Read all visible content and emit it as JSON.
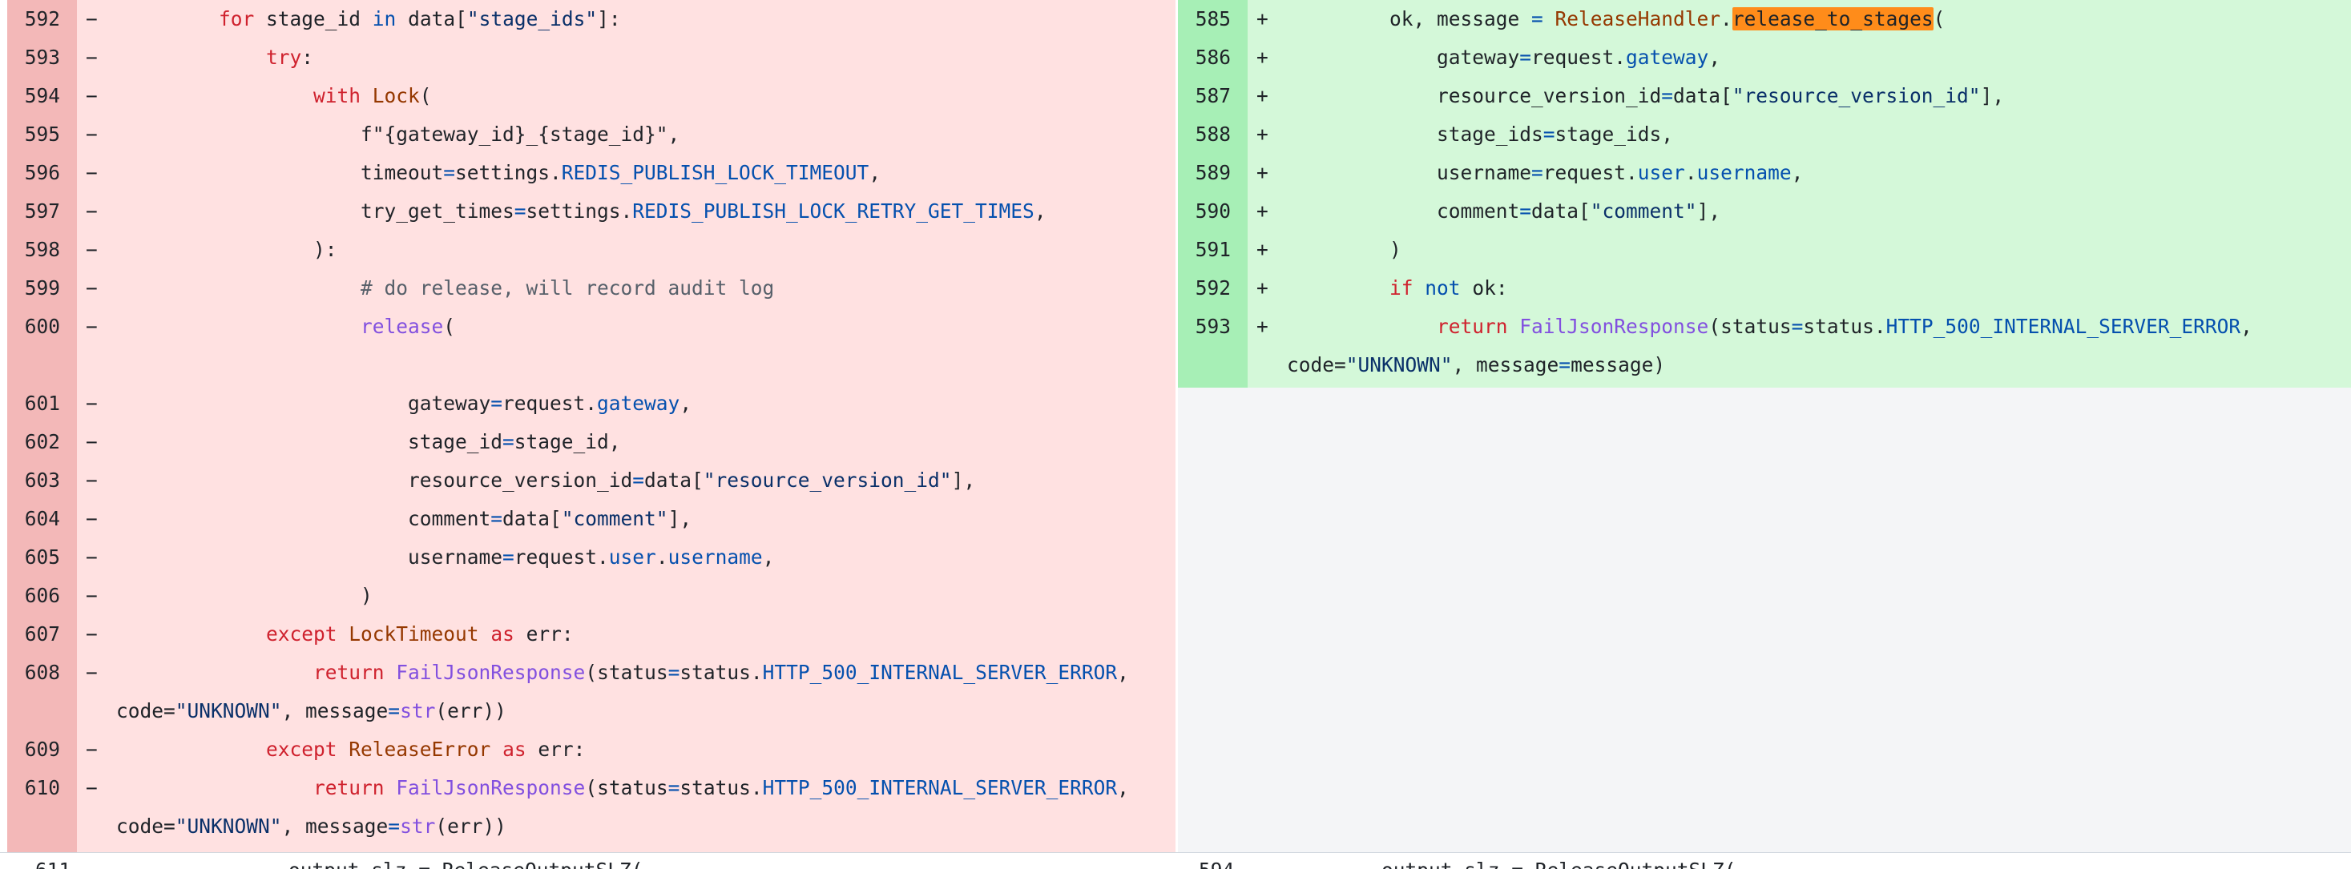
{
  "left": {
    "sign": "−",
    "rows": [
      {
        "ln": "592",
        "segs": [
          [
            "",
            "        "
          ],
          [
            "kw",
            "for"
          ],
          [
            "",
            " stage_id "
          ],
          [
            "kw2",
            "in"
          ],
          [
            "",
            " data["
          ],
          [
            "str",
            "\"stage_ids\""
          ],
          [
            "",
            "]:"
          ]
        ]
      },
      {
        "ln": "593",
        "segs": [
          [
            "",
            "            "
          ],
          [
            "kw",
            "try"
          ],
          [
            "",
            ":"
          ]
        ]
      },
      {
        "ln": "594",
        "segs": [
          [
            "",
            "                "
          ],
          [
            "kw",
            "with"
          ],
          [
            "fn",
            " Lock"
          ],
          [
            "",
            "("
          ]
        ]
      },
      {
        "ln": "595",
        "segs": [
          [
            "",
            "                    "
          ],
          [
            "",
            "f\"{gateway_id}_{stage_id}\","
          ]
        ]
      },
      {
        "ln": "596",
        "segs": [
          [
            "",
            "                    timeout"
          ],
          [
            "kw2",
            "="
          ],
          [
            "",
            "settings."
          ],
          [
            "attr",
            "REDIS_PUBLISH_LOCK_TIMEOUT"
          ],
          [
            "",
            ","
          ]
        ]
      },
      {
        "ln": "597",
        "segs": [
          [
            "",
            "                    try_get_times"
          ],
          [
            "kw2",
            "="
          ],
          [
            "",
            "settings."
          ],
          [
            "attr",
            "REDIS_PUBLISH_LOCK_RETRY_GET_TIMES"
          ],
          [
            "",
            ","
          ]
        ]
      },
      {
        "ln": "598",
        "segs": [
          [
            "",
            "                ):"
          ]
        ]
      },
      {
        "ln": "599",
        "segs": [
          [
            "cm",
            "                    # do release, will record audit log"
          ]
        ]
      },
      {
        "ln": "600",
        "segs": [
          [
            "",
            "                    "
          ],
          [
            "cls",
            "release"
          ],
          [
            "",
            "("
          ]
        ]
      },
      {
        "ln": "",
        "segs": [
          [
            "",
            ""
          ]
        ]
      },
      {
        "ln": "601",
        "segs": [
          [
            "",
            "                        gateway"
          ],
          [
            "kw2",
            "="
          ],
          [
            "",
            "request."
          ],
          [
            "attr",
            "gateway"
          ],
          [
            "",
            ","
          ]
        ]
      },
      {
        "ln": "602",
        "segs": [
          [
            "",
            "                        stage_id"
          ],
          [
            "kw2",
            "="
          ],
          [
            "",
            "stage_id,"
          ]
        ]
      },
      {
        "ln": "603",
        "segs": [
          [
            "",
            "                        resource_version_id"
          ],
          [
            "kw2",
            "="
          ],
          [
            "",
            "data["
          ],
          [
            "str",
            "\"resource_version_id\""
          ],
          [
            "",
            "],"
          ]
        ]
      },
      {
        "ln": "604",
        "segs": [
          [
            "",
            "                        comment"
          ],
          [
            "kw2",
            "="
          ],
          [
            "",
            "data["
          ],
          [
            "str",
            "\"comment\""
          ],
          [
            "",
            "],"
          ]
        ]
      },
      {
        "ln": "605",
        "segs": [
          [
            "",
            "                        username"
          ],
          [
            "kw2",
            "="
          ],
          [
            "",
            "request."
          ],
          [
            "attr",
            "user"
          ],
          [
            "",
            "."
          ],
          [
            "attr",
            "username"
          ],
          [
            "",
            ","
          ]
        ]
      },
      {
        "ln": "606",
        "segs": [
          [
            "",
            "                    )"
          ]
        ]
      },
      {
        "ln": "607",
        "segs": [
          [
            "",
            "            "
          ],
          [
            "kw",
            "except"
          ],
          [
            "fn",
            " LockTimeout"
          ],
          [
            "",
            " "
          ],
          [
            "kw",
            "as"
          ],
          [
            "",
            " err:"
          ]
        ]
      },
      {
        "ln": "608",
        "segs": [
          [
            "",
            "                "
          ],
          [
            "kw",
            "return"
          ],
          [
            "",
            " "
          ],
          [
            "cls",
            "FailJsonResponse"
          ],
          [
            "",
            "(status"
          ],
          [
            "kw2",
            "="
          ],
          [
            "",
            "status."
          ],
          [
            "attr",
            "HTTP_500_INTERNAL_SERVER_ERROR"
          ],
          [
            "",
            ","
          ]
        ]
      },
      {
        "ln": "",
        "cont": true,
        "segs": [
          [
            "",
            "code="
          ],
          [
            "str",
            "\"UNKNOWN\""
          ],
          [
            "",
            ", message"
          ],
          [
            "kw2",
            "="
          ],
          [
            "cls",
            "str"
          ],
          [
            "",
            "(err))"
          ]
        ]
      },
      {
        "ln": "609",
        "segs": [
          [
            "",
            "            "
          ],
          [
            "kw",
            "except"
          ],
          [
            "fn",
            " ReleaseError"
          ],
          [
            "",
            " "
          ],
          [
            "kw",
            "as"
          ],
          [
            "",
            " err:"
          ]
        ]
      },
      {
        "ln": "610",
        "segs": [
          [
            "",
            "                "
          ],
          [
            "kw",
            "return"
          ],
          [
            "",
            " "
          ],
          [
            "cls",
            "FailJsonResponse"
          ],
          [
            "",
            "(status"
          ],
          [
            "kw2",
            "="
          ],
          [
            "",
            "status."
          ],
          [
            "attr",
            "HTTP_500_INTERNAL_SERVER_ERROR"
          ],
          [
            "",
            ","
          ]
        ]
      },
      {
        "ln": "",
        "cont": true,
        "segs": [
          [
            "",
            "code="
          ],
          [
            "str",
            "\"UNKNOWN\""
          ],
          [
            "",
            ", message"
          ],
          [
            "kw2",
            "="
          ],
          [
            "cls",
            "str"
          ],
          [
            "",
            "(err))"
          ]
        ]
      }
    ],
    "next_ln": "611",
    "next_code": "        output_slz = ReleaseOutputSLZ("
  },
  "right": {
    "sign": "+",
    "rows": [
      {
        "ln": "585",
        "segs": [
          [
            "",
            "        ok, message "
          ],
          [
            "kw2",
            "="
          ],
          [
            "fn",
            " ReleaseHandler"
          ],
          [
            "",
            "."
          ],
          [
            "hl",
            "release_to_stages"
          ],
          [
            "",
            "("
          ]
        ]
      },
      {
        "ln": "586",
        "segs": [
          [
            "",
            "            gateway"
          ],
          [
            "kw2",
            "="
          ],
          [
            "",
            "request."
          ],
          [
            "attr",
            "gateway"
          ],
          [
            "",
            ","
          ]
        ]
      },
      {
        "ln": "587",
        "segs": [
          [
            "",
            "            resource_version_id"
          ],
          [
            "kw2",
            "="
          ],
          [
            "",
            "data["
          ],
          [
            "str",
            "\"resource_version_id\""
          ],
          [
            "",
            "],"
          ]
        ]
      },
      {
        "ln": "588",
        "segs": [
          [
            "",
            "            stage_ids"
          ],
          [
            "kw2",
            "="
          ],
          [
            "",
            "stage_ids,"
          ]
        ]
      },
      {
        "ln": "589",
        "segs": [
          [
            "",
            "            username"
          ],
          [
            "kw2",
            "="
          ],
          [
            "",
            "request."
          ],
          [
            "attr",
            "user"
          ],
          [
            "",
            "."
          ],
          [
            "attr",
            "username"
          ],
          [
            "",
            ","
          ]
        ]
      },
      {
        "ln": "590",
        "segs": [
          [
            "",
            "            comment"
          ],
          [
            "kw2",
            "="
          ],
          [
            "",
            "data["
          ],
          [
            "str",
            "\"comment\""
          ],
          [
            "",
            "],"
          ]
        ]
      },
      {
        "ln": "591",
        "segs": [
          [
            "",
            "        )"
          ]
        ]
      },
      {
        "ln": "592",
        "segs": [
          [
            "",
            "        "
          ],
          [
            "kw",
            "if"
          ],
          [
            "",
            " "
          ],
          [
            "kw2",
            "not"
          ],
          [
            "",
            " ok:"
          ]
        ]
      },
      {
        "ln": "593",
        "segs": [
          [
            "",
            "            "
          ],
          [
            "kw",
            "return"
          ],
          [
            "",
            " "
          ],
          [
            "cls",
            "FailJsonResponse"
          ],
          [
            "",
            "(status"
          ],
          [
            "kw2",
            "="
          ],
          [
            "",
            "status."
          ],
          [
            "attr",
            "HTTP_500_INTERNAL_SERVER_ERROR"
          ],
          [
            "",
            ","
          ]
        ]
      },
      {
        "ln": "",
        "cont": true,
        "segs": [
          [
            "",
            "code="
          ],
          [
            "str",
            "\"UNKNOWN\""
          ],
          [
            "",
            ", message"
          ],
          [
            "kw2",
            "="
          ],
          [
            "",
            "message)"
          ]
        ]
      }
    ],
    "next_ln": "594",
    "next_code": "        output_slz = ReleaseOutputSLZ("
  }
}
